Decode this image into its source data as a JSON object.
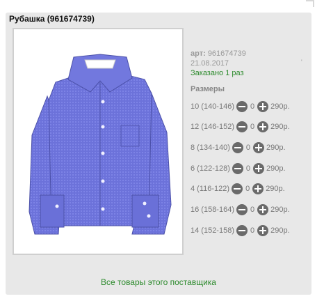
{
  "product": {
    "title": "Рубашка (961674739)",
    "art_label": "арт:",
    "art_value": "961674739",
    "date": "21.08.2017",
    "ordered": "Заказано 1 раз",
    "tick": "'"
  },
  "sizes": {
    "label": "Размеры",
    "rows": [
      {
        "size": "10 (140-146)",
        "qty": "0",
        "price": "290р."
      },
      {
        "size": "12 (146-152)",
        "qty": "0",
        "price": "290р."
      },
      {
        "size": "8 (134-140)",
        "qty": "0",
        "price": "290р."
      },
      {
        "size": "6 (122-128)",
        "qty": "0",
        "price": "290р."
      },
      {
        "size": "4 (116-122)",
        "qty": "0",
        "price": "290р."
      },
      {
        "size": "16 (158-164)",
        "qty": "0",
        "price": "290р."
      },
      {
        "size": "14 (152-158)",
        "qty": "0",
        "price": "290р."
      }
    ]
  },
  "footer": {
    "supplier_link": "Все товары этого поставщика"
  },
  "colors": {
    "shirt": "#6a70d8",
    "link_green": "#2c8a2c",
    "card_bg": "#e8e8e8"
  },
  "icons": [
    "minus-icon",
    "plus-icon"
  ]
}
